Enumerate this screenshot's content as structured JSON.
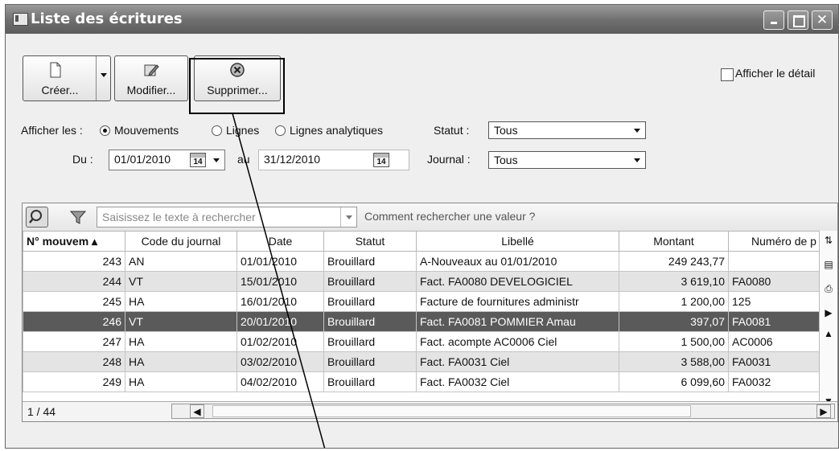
{
  "window": {
    "title": "Liste des écritures"
  },
  "toolbar": {
    "create_label": "Créer...",
    "modify_label": "Modifier...",
    "delete_label": "Supprimer...",
    "show_detail_label": "Afficher le détail"
  },
  "filters": {
    "show_label": "Afficher les :",
    "options": [
      "Mouvements",
      "Lignes",
      "Lignes analytiques"
    ],
    "status_label": "Statut :",
    "status_value": "Tous",
    "from_label": "Du :",
    "from_date": "01/01/2010",
    "to_label": "au",
    "to_date": "31/12/2010",
    "calendar_day": "14",
    "journal_label": "Journal :",
    "journal_value": "Tous"
  },
  "search": {
    "placeholder": "Saisissez le texte à rechercher",
    "help_link": "Comment rechercher une valeur ?"
  },
  "table": {
    "headers": [
      "N° mouvem",
      "Code du journal",
      "Date",
      "Statut",
      "Libellé",
      "Montant",
      "Numéro de p"
    ],
    "rows": [
      [
        "243",
        "AN",
        "01/01/2010",
        "Brouillard",
        "A-Nouveaux au 01/01/2010",
        "249 243,77",
        ""
      ],
      [
        "244",
        "VT",
        "15/01/2010",
        "Brouillard",
        "Fact. FA0080 DEVELOGICIEL",
        "3 619,10",
        "FA0080"
      ],
      [
        "245",
        "HA",
        "16/01/2010",
        "Brouillard",
        "Facture de fournitures administr",
        "1 200,00",
        "125"
      ],
      [
        "246",
        "VT",
        "20/01/2010",
        "Brouillard",
        "Fact. FA0081 POMMIER Amau",
        "397,07",
        "FA0081"
      ],
      [
        "247",
        "HA",
        "01/02/2010",
        "Brouillard",
        "Fact. acompte AC0006 Ciel",
        "1 500,00",
        "AC0006"
      ],
      [
        "248",
        "HA",
        "03/02/2010",
        "Brouillard",
        "Fact. FA0031 Ciel",
        "3 588,00",
        "FA0031"
      ],
      [
        "249",
        "HA",
        "04/02/2010",
        "Brouillard",
        "Fact. FA0032 Ciel",
        "6 099,60",
        "FA0032"
      ]
    ],
    "selected_row": 3
  },
  "footer": {
    "record_count": "1 / 44"
  }
}
